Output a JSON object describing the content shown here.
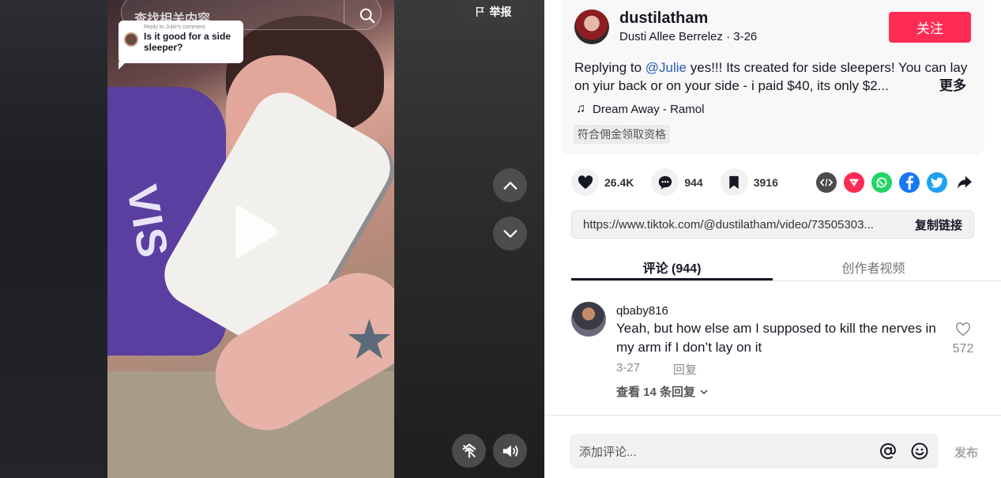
{
  "video": {
    "search_placeholder": "查找相关内容",
    "reply_bubble": {
      "caption": "Reply to Julie's comment",
      "text": "Is it good for a side sleeper?"
    },
    "report_label": "举报",
    "shirt_text": "VIS"
  },
  "author": {
    "username": "dustilatham",
    "display_name": "Dusti Allee Berrelez",
    "separator": " · ",
    "date": "3-26",
    "follow_label": "关注"
  },
  "description": {
    "prefix": "Replying to ",
    "mention": "@Julie",
    "text": " yes!!! Its created for side sleepers! You can lay on yiur back or on your side - i paid $40, its only $2...",
    "more_label": "更多",
    "music": "Dream Away - Ramol",
    "commission_tag": "符合佣金领取资格"
  },
  "stats": {
    "likes": "26.4K",
    "comments": "944",
    "saves": "3916"
  },
  "share": {
    "link": "https://www.tiktok.com/@dustilatham/video/73505303...",
    "copy_label": "复制链接",
    "colors": {
      "embed": "#4b4b4b",
      "send": "#fe2c55",
      "whatsapp": "#25d366",
      "facebook": "#1877f2",
      "twitter": "#1da1f2"
    }
  },
  "tabs": [
    {
      "label": "评论 (944)",
      "active": true
    },
    {
      "label": "创作者视频",
      "active": false
    }
  ],
  "comments": [
    {
      "user": "qbaby816",
      "text": "Yeah, but how else am I supposed to kill the nerves in my arm if I don’t lay on it",
      "date": "3-27",
      "reply_label": "回复",
      "view_replies": "查看 14 条回复",
      "likes": "572"
    }
  ],
  "composer": {
    "placeholder": "添加评论...",
    "post_label": "发布"
  },
  "accent": "#fe2c55"
}
